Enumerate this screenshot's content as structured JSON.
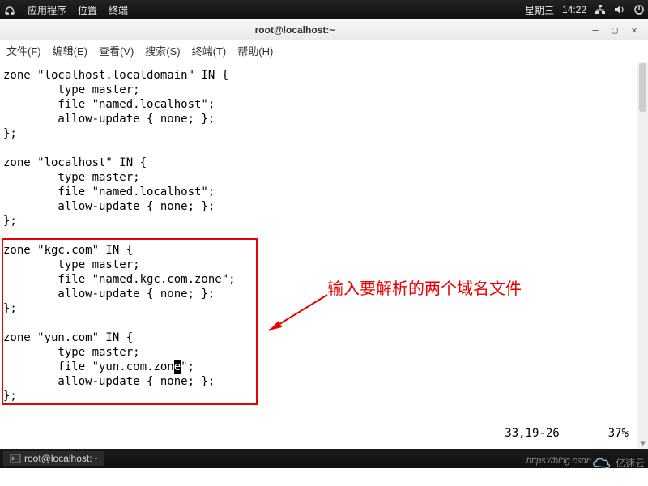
{
  "topbar": {
    "menus": [
      "应用程序",
      "位置",
      "终端"
    ],
    "day": "星期三",
    "time": "14:22"
  },
  "window": {
    "title": "root@localhost:~"
  },
  "termmenu": [
    "文件(F)",
    "编辑(E)",
    "查看(V)",
    "搜索(S)",
    "终端(T)",
    "帮助(H)"
  ],
  "code": {
    "pre1": "zone \"localhost.localdomain\" IN {\n        type master;\n        file \"named.localhost\";\n        allow-update { none; };\n};\n\nzone \"localhost\" IN {\n        type master;\n        file \"named.localhost\";\n        allow-update { none; };\n};\n\nzone \"kgc.com\" IN {\n        type master;\n        file \"named.kgc.com.zone\";\n        allow-update { none; };\n};\n\nzone \"yun.com\" IN {\n        type master;\n        file \"yun.com.zon",
    "cursor": "e",
    "post1": "\";\n        allow-update { none; };\n};"
  },
  "status": {
    "pos": "33,19-26",
    "pct": "37%"
  },
  "annotation": "输入要解析的两个域名文件",
  "task": {
    "label": "root@localhost:~"
  },
  "watermark": "https://blog.csdn",
  "brand": "亿速云"
}
